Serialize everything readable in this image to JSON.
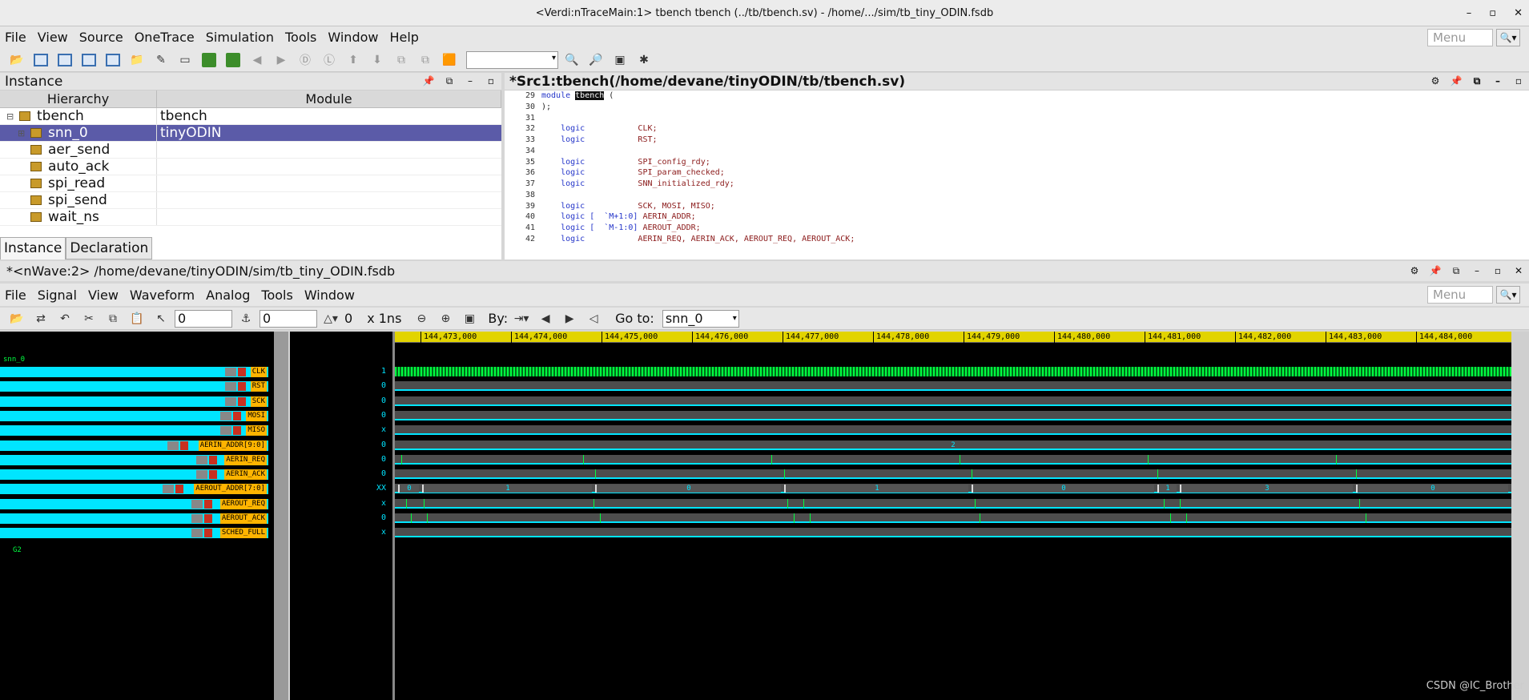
{
  "window": {
    "title": "<Verdi:nTraceMain:1> tbench tbench (../tb/tbench.sv) - /home/.../sim/tb_tiny_ODIN.fsdb",
    "controls": [
      "–",
      "▫",
      "✕"
    ]
  },
  "main_menu": {
    "items": [
      "File",
      "View",
      "Source",
      "OneTrace",
      "Simulation",
      "Tools",
      "Window",
      "Help"
    ],
    "menu_search": "Menu"
  },
  "instance_pane": {
    "title": "Instance",
    "col_hierarchy": "Hierarchy",
    "col_module": "Module",
    "rows": [
      {
        "name": "tbench",
        "module": "tbench",
        "expander": "⊟",
        "selected": false
      },
      {
        "name": "snn_0",
        "module": "tinyODIN",
        "expander": "⊞",
        "selected": true
      },
      {
        "name": "aer_send",
        "module": "",
        "expander": "",
        "selected": false
      },
      {
        "name": "auto_ack",
        "module": "",
        "expander": "",
        "selected": false
      },
      {
        "name": "spi_read",
        "module": "",
        "expander": "",
        "selected": false
      },
      {
        "name": "spi_send",
        "module": "",
        "expander": "",
        "selected": false
      },
      {
        "name": "wait_ns",
        "module": "",
        "expander": "",
        "selected": false
      }
    ],
    "tabs": [
      "Instance",
      "Declaration"
    ]
  },
  "source_pane": {
    "title": "*Src1:tbench(/home/devane/tinyODIN/tb/tbench.sv)",
    "lines": [
      {
        "n": "29",
        "parts": [
          {
            "t": "module ",
            "c": "kw"
          },
          {
            "t": "tbench",
            "c": "hl"
          },
          {
            "t": " (",
            "c": "code"
          }
        ]
      },
      {
        "n": "30",
        "parts": [
          {
            "t": ");",
            "c": "code"
          }
        ]
      },
      {
        "n": "31",
        "parts": []
      },
      {
        "n": "32",
        "parts": [
          {
            "t": "    logic           ",
            "c": "kw"
          },
          {
            "t": "CLK;",
            "c": "sym"
          }
        ]
      },
      {
        "n": "33",
        "parts": [
          {
            "t": "    logic           ",
            "c": "kw"
          },
          {
            "t": "RST;",
            "c": "sym"
          }
        ]
      },
      {
        "n": "34",
        "parts": []
      },
      {
        "n": "35",
        "parts": [
          {
            "t": "    logic           ",
            "c": "kw"
          },
          {
            "t": "SPI_config_rdy;",
            "c": "sym"
          }
        ]
      },
      {
        "n": "36",
        "parts": [
          {
            "t": "    logic           ",
            "c": "kw"
          },
          {
            "t": "SPI_param_checked;",
            "c": "sym"
          }
        ]
      },
      {
        "n": "37",
        "parts": [
          {
            "t": "    logic           ",
            "c": "kw"
          },
          {
            "t": "SNN_initialized_rdy;",
            "c": "sym"
          }
        ]
      },
      {
        "n": "38",
        "parts": []
      },
      {
        "n": "39",
        "parts": [
          {
            "t": "    logic           ",
            "c": "kw"
          },
          {
            "t": "SCK, MOSI, MISO;",
            "c": "sym"
          }
        ]
      },
      {
        "n": "40",
        "parts": [
          {
            "t": "    logic [  `M+1:0] ",
            "c": "kw"
          },
          {
            "t": "AERIN_ADDR;",
            "c": "sym"
          }
        ]
      },
      {
        "n": "41",
        "parts": [
          {
            "t": "    logic [  `M-1:0] ",
            "c": "kw"
          },
          {
            "t": "AEROUT_ADDR;",
            "c": "sym"
          }
        ]
      },
      {
        "n": "42",
        "parts": [
          {
            "t": "    logic           ",
            "c": "kw"
          },
          {
            "t": "AERIN_REQ, AERIN_ACK, AEROUT_REQ, AEROUT_ACK;",
            "c": "sym"
          }
        ]
      }
    ]
  },
  "nwave": {
    "title": "*<nWave:2> /home/devane/tinyODIN/sim/tb_tiny_ODIN.fsdb",
    "menu": [
      "File",
      "Signal",
      "View",
      "Waveform",
      "Analog",
      "Tools",
      "Window"
    ],
    "menu_search": "Menu",
    "cursor_value": "0",
    "marker_value": "0",
    "delta_value": "0",
    "time_unit": "x 1ns",
    "by_label": "By:",
    "goto_label": "Go to:",
    "goto_value": "snn_0",
    "group_label": "snn_0",
    "group2_label": "G2",
    "signals": [
      {
        "name": "CLK",
        "value": "1"
      },
      {
        "name": "RST",
        "value": "0"
      },
      {
        "name": "SCK",
        "value": "0"
      },
      {
        "name": "MOSI",
        "value": "0"
      },
      {
        "name": "MISO",
        "value": "x"
      },
      {
        "name": "AERIN_ADDR[9:0]",
        "value": "0"
      },
      {
        "name": "AERIN_REQ",
        "value": "0"
      },
      {
        "name": "AERIN_ACK",
        "value": "0"
      },
      {
        "name": "AEROUT_ADDR[7:0]",
        "value": "XX"
      },
      {
        "name": "AEROUT_REQ",
        "value": "x"
      },
      {
        "name": "AEROUT_ACK",
        "value": "0"
      },
      {
        "name": "SCHED_FULL",
        "value": "x"
      }
    ],
    "ruler_ticks": [
      "144,473,000",
      "144,474,000",
      "144,475,000",
      "144,476,000",
      "144,477,000",
      "144,478,000",
      "144,479,000",
      "144,480,000",
      "144,481,000",
      "144,482,000",
      "144,483,000",
      "144,484,000"
    ],
    "aerin_addr_value": "2",
    "aerout_addr_segments": [
      "0",
      "1",
      "0",
      "1",
      "0",
      "1",
      "3",
      "0"
    ]
  },
  "watermark": "CSDN @IC_Brother"
}
